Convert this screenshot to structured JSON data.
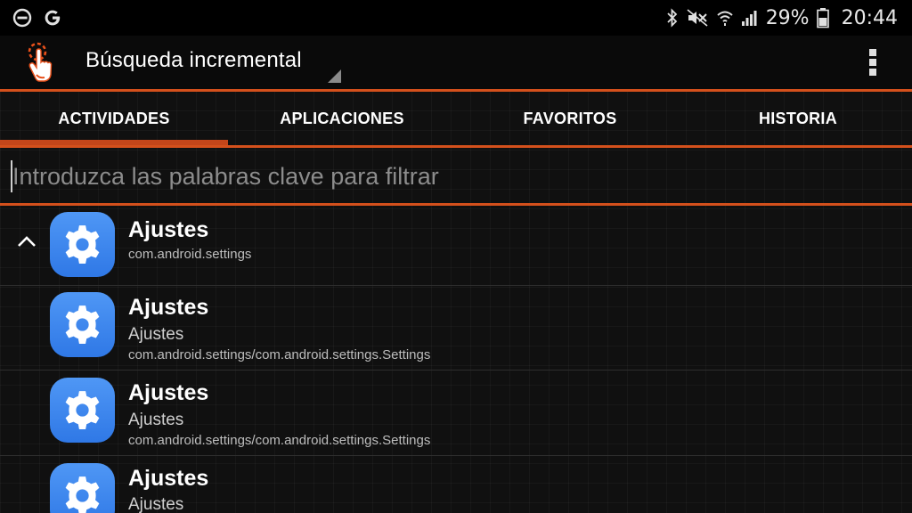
{
  "status_bar": {
    "battery": "29%",
    "time": "20:44",
    "left_icons": [
      "dnd-icon",
      "google-icon"
    ],
    "right_icons": [
      "bluetooth-icon",
      "mute-icon",
      "wifi-icon",
      "signal-icon",
      "battery-icon"
    ]
  },
  "app_bar": {
    "title": "Búsqueda incremental",
    "logo_icon": "pointing-hand-icon",
    "menu_icon": "overflow-menu-icon"
  },
  "tabs": [
    {
      "label": "ACTIVIDADES",
      "selected": true
    },
    {
      "label": "APLICACIONES",
      "selected": false
    },
    {
      "label": "FAVORITOS",
      "selected": false
    },
    {
      "label": "HISTORIA",
      "selected": false
    }
  ],
  "search": {
    "placeholder": "Introduzca las palabras clave para filtrar",
    "value": ""
  },
  "list": {
    "items": [
      {
        "title": "Ajustes",
        "package": "com.android.settings"
      },
      {
        "title": "Ajustes",
        "subtitle": "Ajustes",
        "component": "com.android.settings/com.android.settings.Settings"
      },
      {
        "title": "Ajustes",
        "subtitle": "Ajustes",
        "component": "com.android.settings/com.android.settings.Settings"
      },
      {
        "title": "Ajustes",
        "subtitle": "Ajustes"
      }
    ]
  },
  "colors": {
    "accent": "#d4501c",
    "icon_blue": "#3a85ee",
    "background": "#101010"
  }
}
